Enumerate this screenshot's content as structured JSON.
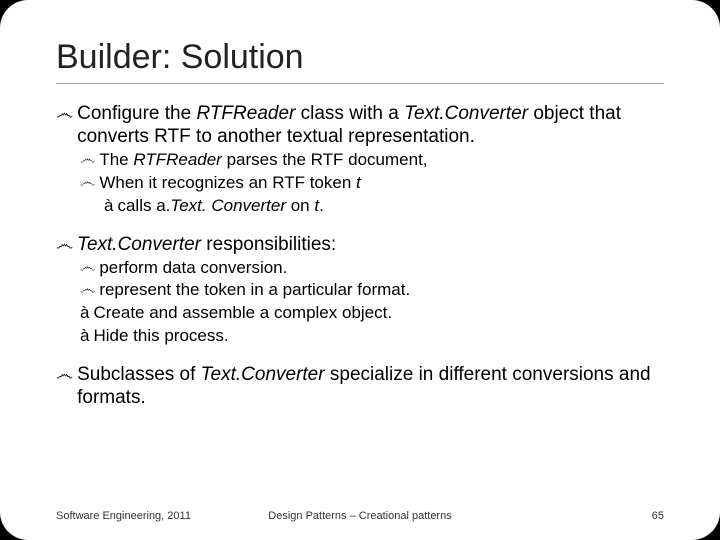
{
  "title": "Builder: Solution",
  "bullets": {
    "b1_pre": "Configure the ",
    "b1_em1": "RTFReader",
    "b1_mid": " class with a ",
    "b1_em2": "Text.Converter",
    "b1_post": " object that converts RTF to another textual representation.",
    "b1a_pre": "The ",
    "b1a_em": "RTFReader",
    "b1a_post": " parses the RTF document,",
    "b1b_pre": "When it recognizes an RTF token ",
    "b1b_em": "t",
    "b1c_pre": "  calls a.",
    "b1c_em1": "Text. Converter",
    "b1c_mid": " on ",
    "b1c_em2": "t",
    "b1c_post": ".",
    "b2_em": "Text.Converter",
    "b2_post": "  responsibilities:",
    "b2a": "perform data conversion.",
    "b2b": "represent the token in a particular format.",
    "b2c": "Create and assemble a complex object.",
    "b2d": "Hide this process.",
    "b3_pre": "Subclasses of ",
    "b3_em": "Text.Converter",
    "b3_post": " specialize in different conversions and formats."
  },
  "marks": {
    "curly": "෴",
    "arrow": "à",
    "calls_arrow": "à"
  },
  "footer": {
    "left": "Software Engineering, 2011",
    "center": "Design Patterns – Creational patterns",
    "right": "65"
  }
}
